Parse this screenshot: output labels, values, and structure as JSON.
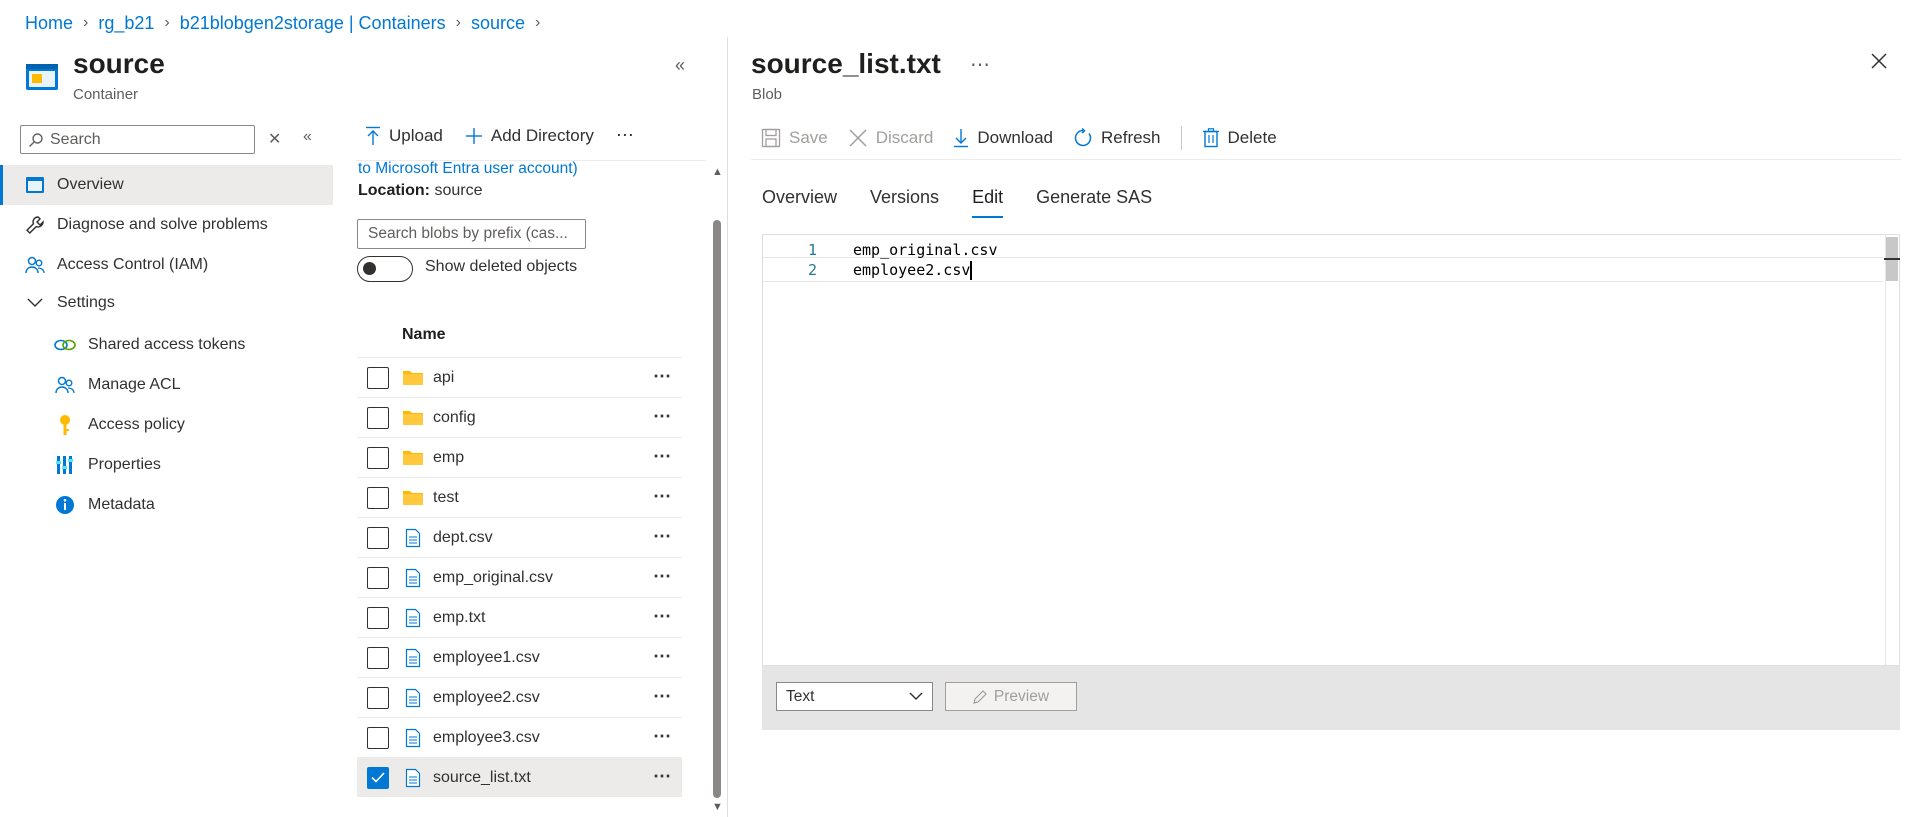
{
  "breadcrumb": [
    "Home",
    "rg_b21",
    "b21blobgen2storage | Containers",
    "source"
  ],
  "left_blade": {
    "title": "source",
    "subtitle": "Container",
    "search_placeholder": "Search",
    "nav": [
      {
        "label": "Overview",
        "icon": "overview-icon",
        "selected": true
      },
      {
        "label": "Diagnose and solve problems",
        "icon": "wrench-icon"
      },
      {
        "label": "Access Control (IAM)",
        "icon": "people-icon"
      },
      {
        "label": "Settings",
        "icon": "chevron-down-icon"
      },
      {
        "label": "Shared access tokens",
        "icon": "link-icon"
      },
      {
        "label": "Manage ACL",
        "icon": "people-icon"
      },
      {
        "label": "Access policy",
        "icon": "key-icon"
      },
      {
        "label": "Properties",
        "icon": "bars-icon"
      },
      {
        "label": "Metadata",
        "icon": "info-icon"
      }
    ]
  },
  "middle": {
    "toolbar": {
      "upload": "Upload",
      "add_directory": "Add Directory"
    },
    "auth_link": "to Microsoft Entra user account)",
    "location_label": "Location:",
    "location_value": "source",
    "blob_search_placeholder": "Search blobs by prefix (cas...",
    "show_deleted_label": "Show deleted objects",
    "column_name": "Name",
    "rows": [
      {
        "name": "api",
        "type": "folder"
      },
      {
        "name": "config",
        "type": "folder"
      },
      {
        "name": "emp",
        "type": "folder"
      },
      {
        "name": "test",
        "type": "folder"
      },
      {
        "name": "dept.csv",
        "type": "file"
      },
      {
        "name": "emp_original.csv",
        "type": "file"
      },
      {
        "name": "emp.txt",
        "type": "file"
      },
      {
        "name": "employee1.csv",
        "type": "file"
      },
      {
        "name": "employee2.csv",
        "type": "file"
      },
      {
        "name": "employee3.csv",
        "type": "file"
      },
      {
        "name": "source_list.txt",
        "type": "file",
        "selected": true
      }
    ]
  },
  "right_blade": {
    "title": "source_list.txt",
    "subtitle": "Blob",
    "toolbar": {
      "save": "Save",
      "discard": "Discard",
      "download": "Download",
      "refresh": "Refresh",
      "delete": "Delete"
    },
    "tabs": [
      "Overview",
      "Versions",
      "Edit",
      "Generate SAS"
    ],
    "active_tab": "Edit",
    "editor_lines": [
      {
        "num": "1",
        "text": "emp_original.csv"
      },
      {
        "num": "2",
        "text": "employee2.csv"
      }
    ],
    "content_type": "Text",
    "preview_label": "Preview"
  },
  "colors": {
    "accent": "#0078d4",
    "folder": "#ffb900",
    "text": "#323130"
  }
}
